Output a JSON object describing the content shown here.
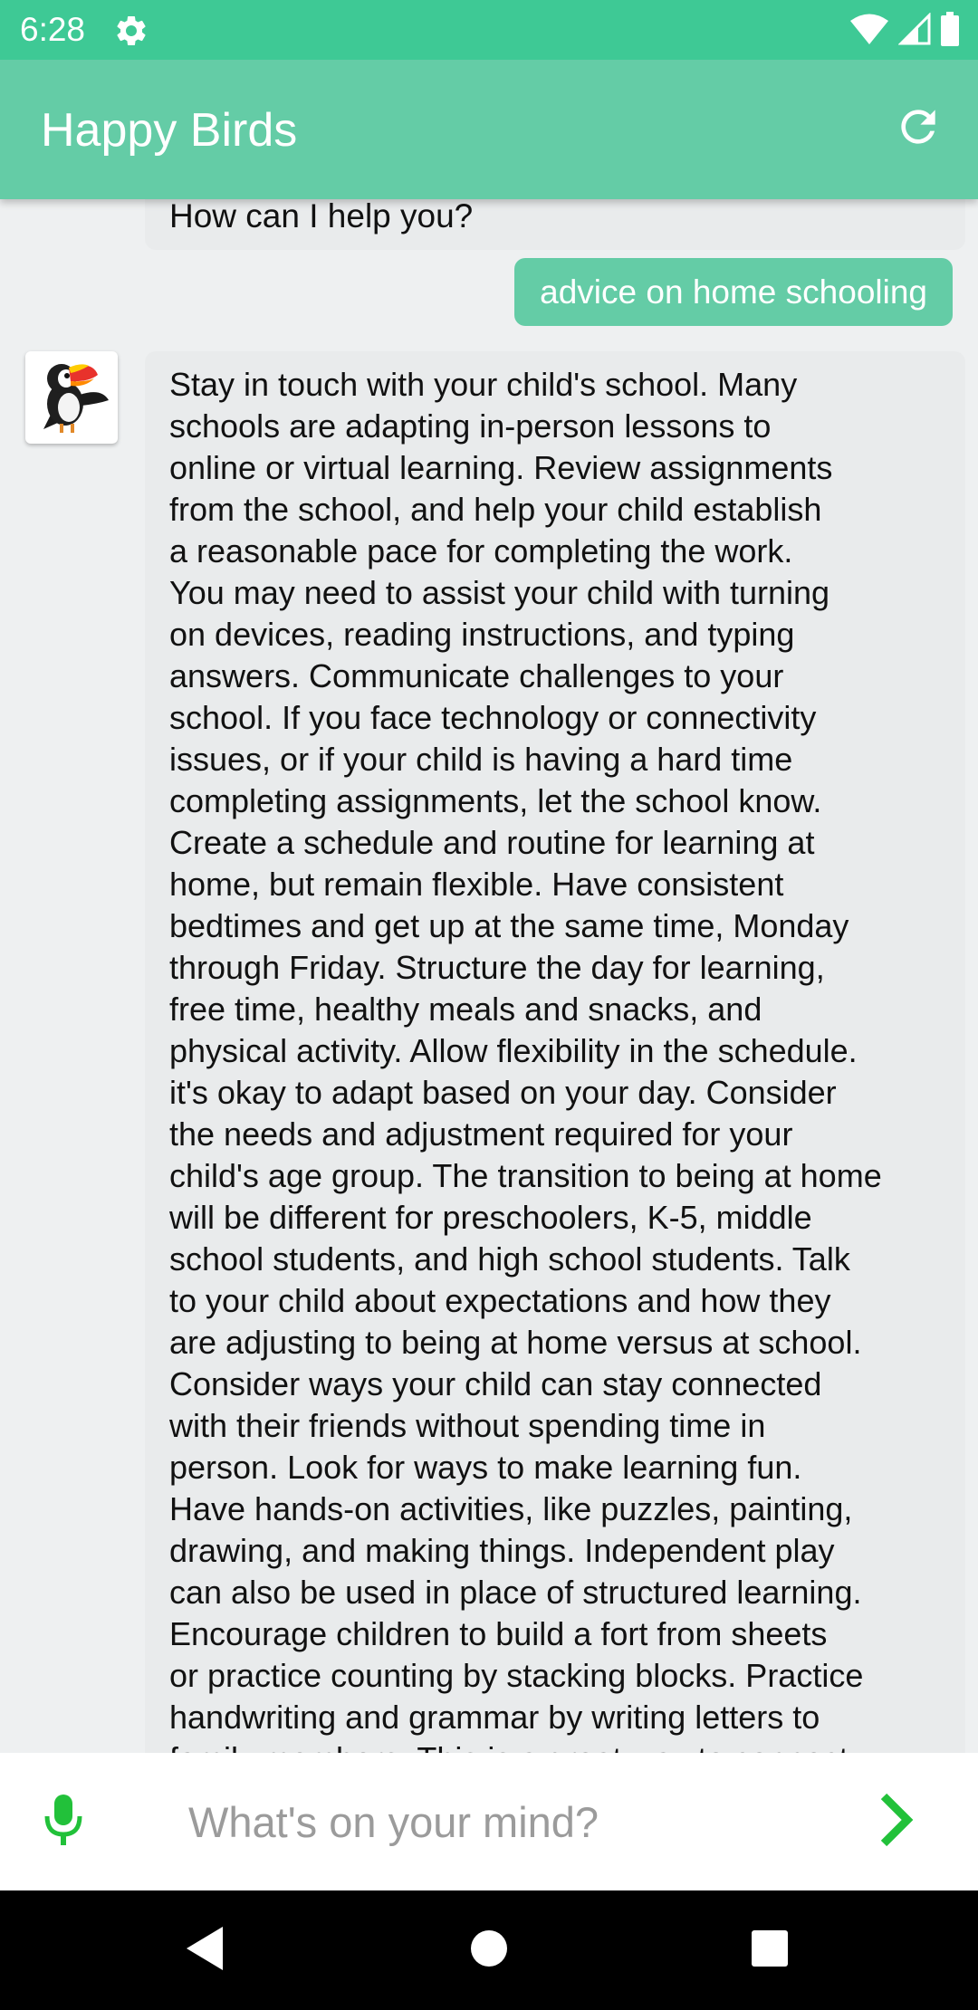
{
  "status_bar": {
    "time": "6:28",
    "icons": [
      "gear-icon",
      "wifi-icon",
      "signal-icon",
      "battery-icon"
    ]
  },
  "app_bar": {
    "title": "Happy Birds",
    "refresh_icon": "refresh-icon"
  },
  "chat": {
    "messages": [
      {
        "sender": "bot",
        "text": "How can I help you?"
      },
      {
        "sender": "user",
        "text": "advice on home schooling"
      },
      {
        "sender": "bot",
        "avatar": "toucan-avatar",
        "text": "Stay in touch with your child's school. Many\nschools are adapting in-person lessons to\nonline or virtual learning. Review assignments\nfrom the school, and help your child establish\na reasonable pace for completing the work.\nYou may need to assist your child with turning\non devices, reading instructions, and typing\nanswers. Communicate challenges to your\nschool. If you face technology or connectivity\nissues, or if your child is having a hard time\ncompleting assignments, let the school know.\nCreate a schedule and routine for learning at\nhome, but remain flexible. Have consistent\nbedtimes and get up at the same time, Monday\nthrough Friday. Structure the day for learning,\nfree time, healthy meals and snacks, and\nphysical activity. Allow flexibility in the schedule.\nit's okay to adapt based on your day. Consider\nthe needs and adjustment required for your\nchild's age group. The transition to being at home\nwill be different for preschoolers, K-5, middle\nschool students, and high school students. Talk\nto your child about expectations and how they\nare adjusting to being at home versus at school.\nConsider ways your child can stay connected\nwith their friends without spending time in\nperson. Look for ways to make learning fun.\nHave hands-on activities, like puzzles, painting,\ndrawing, and making things. Independent play\ncan also be used in place of structured learning.\nEncourage children to build a fort from sheets\nor practice counting by stacking blocks. Practice\nhandwriting and grammar by writing letters to\nfamily members. This is a great way to connect"
      }
    ]
  },
  "input_bar": {
    "placeholder": "What's on your mind?",
    "value": "",
    "mic_icon": "mic-icon",
    "send_icon": "send-chevron-icon"
  },
  "nav_bar": {
    "icons": [
      "back-icon",
      "home-icon",
      "recents-icon"
    ]
  },
  "colors": {
    "status_bar": "#3ec995",
    "app_bar": "#64cca6",
    "user_bubble": "#64cca6",
    "bot_bubble": "#e9ebec",
    "accent_green": "#22c13a",
    "background": "#eef0f1"
  }
}
